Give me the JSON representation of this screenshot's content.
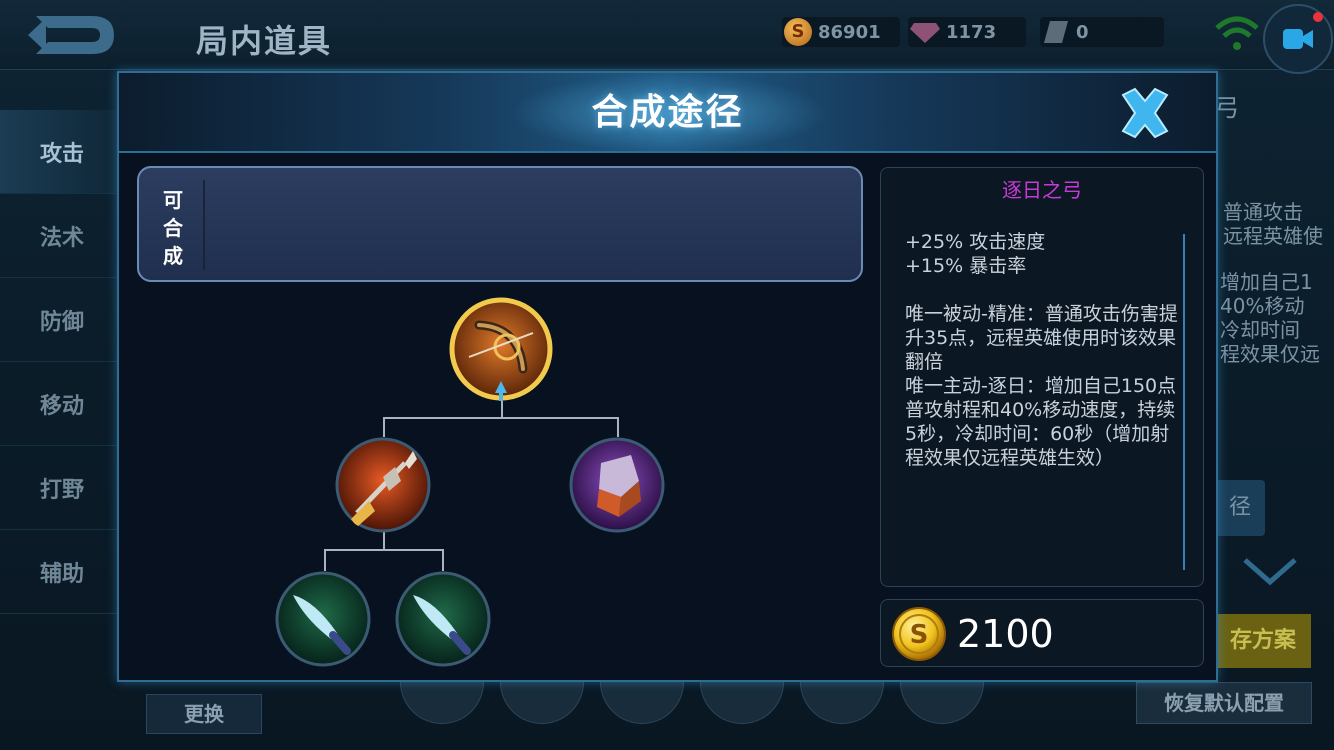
{
  "app": {
    "bg_title": "局内道具",
    "currency": {
      "gold": "86901",
      "diamond": "1173",
      "ticket": "0"
    }
  },
  "sidebar": {
    "items": [
      {
        "label": "攻击"
      },
      {
        "label": "法术"
      },
      {
        "label": "防御"
      },
      {
        "label": "移动"
      },
      {
        "label": "打野"
      },
      {
        "label": "辅助"
      }
    ]
  },
  "background_right": {
    "title_fragment": "弓",
    "line1": "普通攻击",
    "line2": "远程英雄使",
    "line3": "增加自己1",
    "line4": "40%移动",
    "line5": "冷却时间",
    "line6": "程效果仅远",
    "btn_fragment": "径",
    "plan_fragment": "存方案",
    "reset_label": "恢复默认配置"
  },
  "bottom": {
    "change_label": "更换"
  },
  "modal": {
    "title": "合成途径",
    "craft_label": "可合成",
    "tree": {
      "root": "long-bow-icon",
      "mid": [
        "spear-icon",
        "cape-icon"
      ],
      "leaf": [
        "dagger-icon",
        "dagger-icon"
      ]
    },
    "item": {
      "name": "逐日之弓",
      "name_color": "#c83ad6",
      "stats": [
        "+25% 攻击速度",
        "+15% 暴击率"
      ],
      "passive": "唯一被动-精准：普通攻击伤害提升35点，远程英雄使用时该效果翻倍",
      "active": "唯一主动-逐日：增加自己150点普攻射程和40%移动速度，持续5秒，冷却时间：60秒（增加射程效果仅远程英雄生效）"
    },
    "price": "2100"
  }
}
